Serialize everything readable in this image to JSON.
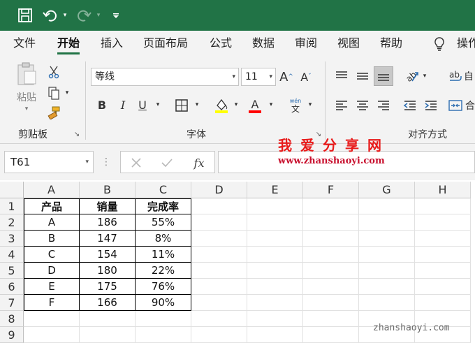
{
  "quick_access": {
    "save_icon": "save-icon",
    "undo_icon": "undo-icon",
    "redo_icon": "redo-icon",
    "customize_icon": "customize-quick-access-icon"
  },
  "tabs": [
    {
      "label": "文件",
      "active": false
    },
    {
      "label": "开始",
      "active": true
    },
    {
      "label": "插入",
      "active": false
    },
    {
      "label": "页面布局",
      "active": false
    },
    {
      "label": "公式",
      "active": false
    },
    {
      "label": "数据",
      "active": false
    },
    {
      "label": "审阅",
      "active": false
    },
    {
      "label": "视图",
      "active": false
    },
    {
      "label": "帮助",
      "active": false
    }
  ],
  "tell_me": {
    "label": "操作",
    "icon": "lightbulb-icon"
  },
  "ribbon": {
    "clipboard": {
      "paste_label": "粘贴",
      "group_label": "剪贴板"
    },
    "font": {
      "font_name": "等线",
      "font_size": "11",
      "group_label": "字体",
      "bold": "B",
      "italic": "I",
      "underline": "U",
      "phonetic_top": "wén",
      "phonetic_bottom": "文",
      "highlight_color": "#ffff00",
      "font_color": "#ff0000"
    },
    "alignment": {
      "group_label": "对齐方式",
      "wrap_label": "自",
      "merge_label": "合"
    }
  },
  "formula_bar": {
    "name_box": "T61",
    "cancel_icon": "cancel-icon",
    "enter_icon": "check-icon",
    "fx_label": "fx",
    "formula": ""
  },
  "watermark": {
    "title": "我爱分享网",
    "url": "www.zhanshaoyi.com",
    "footer": "zhanshaoyi.com"
  },
  "sheet": {
    "columns": [
      "A",
      "B",
      "C",
      "D",
      "E",
      "F",
      "G",
      "H"
    ],
    "rows": [
      "1",
      "2",
      "3",
      "4",
      "5",
      "6",
      "7",
      "8",
      "9"
    ],
    "headers": [
      "产品",
      "销量",
      "完成率"
    ],
    "data": [
      [
        "A",
        "186",
        "55%"
      ],
      [
        "B",
        "147",
        "8%"
      ],
      [
        "C",
        "154",
        "11%"
      ],
      [
        "D",
        "180",
        "22%"
      ],
      [
        "E",
        "175",
        "76%"
      ],
      [
        "F",
        "166",
        "90%"
      ]
    ]
  }
}
